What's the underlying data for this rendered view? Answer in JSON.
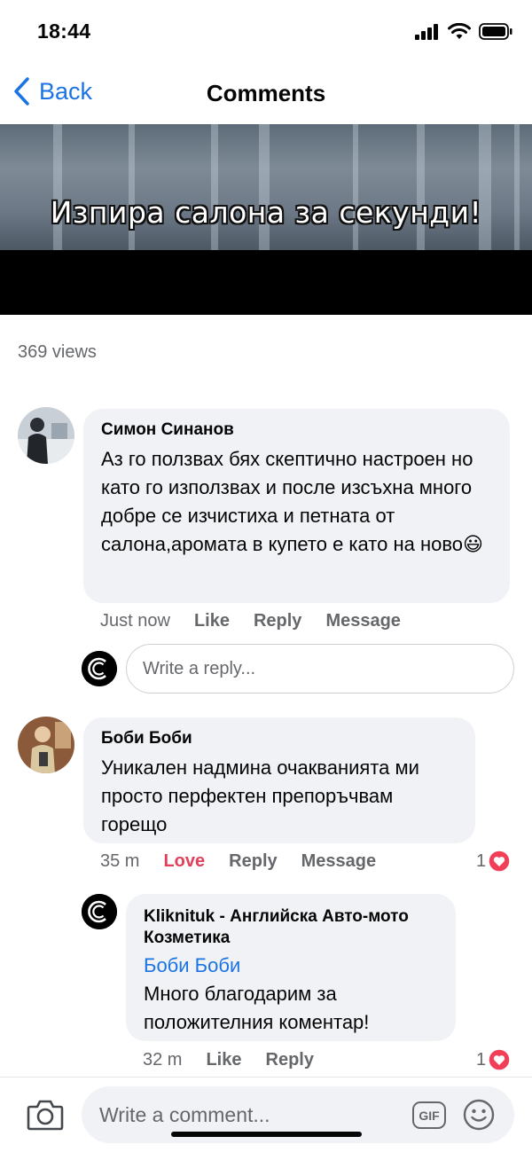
{
  "status_bar": {
    "time": "18:44"
  },
  "nav": {
    "back_label": "Back",
    "title": "Comments"
  },
  "video": {
    "caption": "Изпира салона за секунди!"
  },
  "views": "369 views",
  "comments": [
    {
      "author": "Симон Синанов",
      "text": "Аз го ползвах бях скептично настроен но като го използвах и после изсъхна много добре се изчистиха и петната от салона,аромата в купето е като на ново",
      "emoji": "😃",
      "time": "Just now",
      "like_label": "Like",
      "reply_label": "Reply",
      "message_label": "Message",
      "reply_placeholder": "Write a reply..."
    },
    {
      "author": "Боби Боби",
      "text": "Уникален надмина очакванията ми просто перфектен препоръчвам горещо",
      "time": "35 m",
      "love_label": "Love",
      "reply_label": "Reply",
      "message_label": "Message",
      "reaction_count": "1",
      "reply": {
        "author": "Kliknituk - Английска Авто-мото Козметика",
        "mention": "Боби Боби",
        "text": "Много благодарим за положителния коментар!",
        "time": "32 m",
        "like_label": "Like",
        "reply_label": "Reply",
        "reaction_count": "1"
      }
    }
  ],
  "composer": {
    "placeholder": "Write a comment...",
    "gif_label": "GIF"
  },
  "icons": [
    "signal-icon",
    "wifi-icon",
    "battery-icon",
    "back-chevron-icon",
    "camera-icon",
    "emoji-icon",
    "love-reaction-icon",
    "brand-logo-icon"
  ],
  "colors": {
    "link": "#1b74e4",
    "love": "#e0405c",
    "bubble": "#f0f2f5",
    "secondary_text": "#65676b"
  }
}
